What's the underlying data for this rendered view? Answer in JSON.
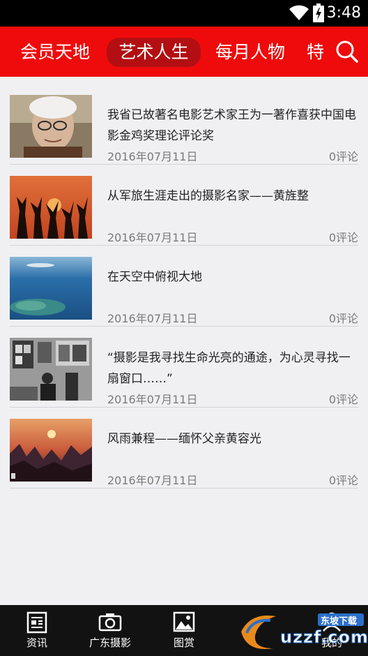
{
  "status_bar": {
    "time": "3:48"
  },
  "top_nav": {
    "tabs": [
      "会员天地",
      "艺术人生",
      "每月人物",
      "特"
    ],
    "active_tab": 1
  },
  "news": [
    {
      "title": "我省已故著名电影艺术家王为一著作喜获中国电影金鸡奖理论评论奖",
      "date": "2016年07月11日",
      "comments": "0评论",
      "thumb_icon": "elderly-man-portrait"
    },
    {
      "title": "从军旅生涯走出的摄影名家——黄旌整",
      "date": "2016年07月11日",
      "comments": "0评论",
      "thumb_icon": "soldiers-silhouette-sunset"
    },
    {
      "title": "在天空中俯视大地",
      "date": "2016年07月11日",
      "comments": "0评论",
      "thumb_icon": "aerial-sea-island"
    },
    {
      "title": "“摄影是我寻找生命光亮的通途，为心灵寻找一扇窗口……”",
      "date": "2016年07月11日",
      "comments": "0评论",
      "thumb_icon": "street-bw-photo"
    },
    {
      "title": "风雨兼程——缅怀父亲黄容光",
      "date": "2016年07月11日",
      "comments": "0评论",
      "thumb_icon": "mountain-sunset-painting"
    }
  ],
  "bottom_nav": [
    "资讯",
    "广东摄影",
    "图赏",
    "我的"
  ],
  "watermark": {
    "text": "uzzf.com",
    "label": "东坡下载"
  },
  "colors": {
    "accent": "#ef0b0b",
    "active_tab_bg": "#b30f12",
    "bottom_bar": "#121212"
  }
}
